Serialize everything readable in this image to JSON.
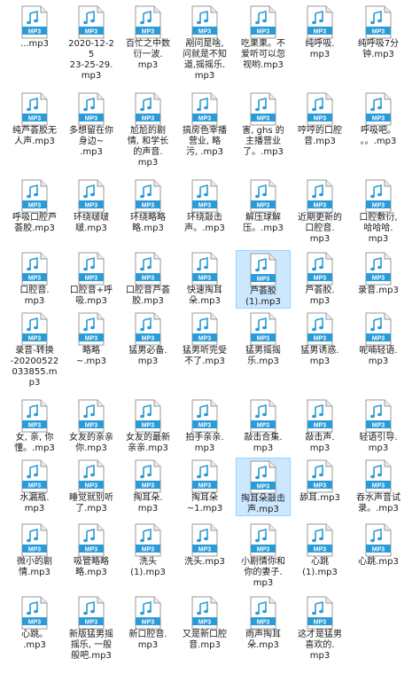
{
  "icon_badge": "MP3",
  "colors": {
    "accent": "#2b9bd7",
    "selected_bg": "#cce8ff",
    "selected_border": "#99d1ff"
  },
  "files": [
    {
      "label": "...mp3"
    },
    {
      "label": "2020-12-2\n5\n23-25-29.\nmp3"
    },
    {
      "label": "百忙之中数\n衍一波.\nmp3"
    },
    {
      "label": "剐问是啥,\n问就是不知\n道,摇摇乐.\nmp3"
    },
    {
      "label": "吃果果。不\n爱听可以忽\n视哟.mp3"
    },
    {
      "label": "纯呼吸.\nmp3"
    },
    {
      "label": "纯呼吸7分\n钟.mp3"
    },
    {
      "label": "纯芦荟胶无\n人声.mp3"
    },
    {
      "label": "多想留在你\n身边~\n.mp3"
    },
    {
      "label": "尬尬的剧\n情, 和学长\n的声音.\nmp3"
    },
    {
      "label": "搞房色宰播\n营业, 略\n污, .mp3"
    },
    {
      "label": "害, ghs 的\n主播营业\n了。.mp3"
    },
    {
      "label": "哼哼的口腔\n音.mp3"
    },
    {
      "label": "呼吸吧。\n。。.mp3"
    },
    {
      "label": "呼吸口腔芦\n荟胶.mp3"
    },
    {
      "label": "环绕啵啵\n啵.mp3"
    },
    {
      "label": "环绕略略\n略.mp3"
    },
    {
      "label": "环绕敲击\n声。.mp3"
    },
    {
      "label": "解压球解\n压。.mp3"
    },
    {
      "label": "近期更新的\n口腔音.\nmp3"
    },
    {
      "label": "口腔敷衍,\n哈哈哈.\nmp3"
    },
    {
      "label": "口腔音.\nmp3"
    },
    {
      "label": "口腔音+呼\n吸.mp3"
    },
    {
      "label": "口腔音芦荟\n胶.mp3"
    },
    {
      "label": "快速掏耳\n朵.mp3"
    },
    {
      "label": "芦荟胶\n(1).mp3",
      "selected": true
    },
    {
      "label": "芦荟胶.\nmp3"
    },
    {
      "label": "录音.mp3"
    },
    {
      "label": "录音-转换\n-20200522\n033855.m\np3"
    },
    {
      "label": "略略\n~.mp3"
    },
    {
      "label": "猛男必备.\nmp3"
    },
    {
      "label": "猛男听完受\n不了.mp3"
    },
    {
      "label": "猛男摇摇\n乐.mp3"
    },
    {
      "label": "猛男诱惑.\nmp3"
    },
    {
      "label": "呢喃轻语.\nmp3"
    },
    {
      "label": "女, 亲, 你\n懂。.mp3"
    },
    {
      "label": "女友的亲亲\n你.mp3"
    },
    {
      "label": "女友的最新\n亲亲.mp3"
    },
    {
      "label": "拍手亲亲.\nmp3"
    },
    {
      "label": "敲击合集.\nmp3"
    },
    {
      "label": "敲击声.\nmp3"
    },
    {
      "label": "轻语引导.\nmp3"
    },
    {
      "label": "水漏瓶.\nmp3"
    },
    {
      "label": "睡觉就别听\n了.mp3"
    },
    {
      "label": "掏耳朵.\nmp3"
    },
    {
      "label": "掏耳朵\n~1.mp3"
    },
    {
      "label": "掏耳朵敲击\n声.mp3",
      "selected": true
    },
    {
      "label": "舔耳.mp3"
    },
    {
      "label": "吞水声音试\n录。.mp3"
    },
    {
      "label": "微小的剧\n情.mp3"
    },
    {
      "label": "吸管略略\n略.mp3"
    },
    {
      "label": "洗头\n(1).mp3"
    },
    {
      "label": "洗头.mp3"
    },
    {
      "label": "小剧情你和\n你的妻子.\nmp3"
    },
    {
      "label": "心跳\n(1).mp3"
    },
    {
      "label": "心跳.mp3"
    },
    {
      "label": "心跳。\n.mp3"
    },
    {
      "label": "新版猛男摇\n摇乐, 一般\n般吧.mp3"
    },
    {
      "label": "新口腔音.\nmp3"
    },
    {
      "label": "又是新口腔\n音.mp3"
    },
    {
      "label": "雨声掏耳\n朵.mp3"
    },
    {
      "label": "这才是猛男\n喜欢的.\nmp3"
    }
  ]
}
